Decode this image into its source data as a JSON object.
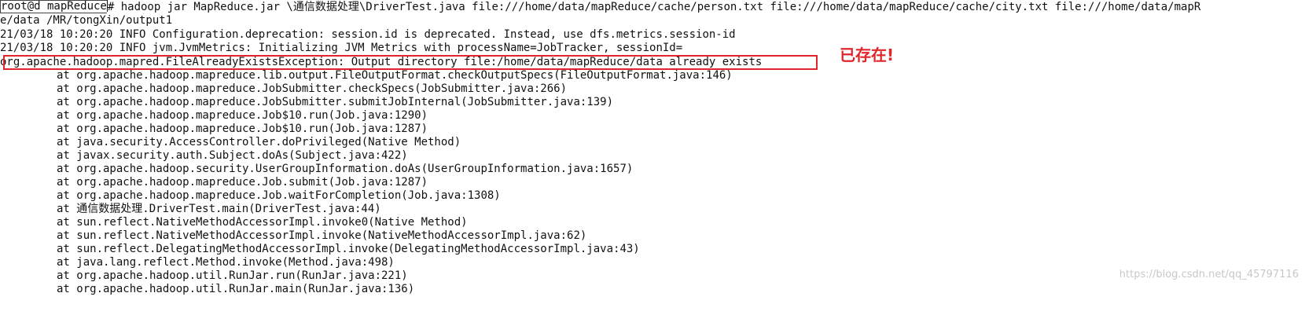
{
  "terminal": {
    "prompt": {
      "user_host": "root@d mapReduce",
      "symbol": "# ",
      "command": "hadoop jar MapReduce.jar \\通信数据处理\\DriverTest.java file:///home/data/mapReduce/cache/person.txt file:///home/data/mapReduce/cache/city.txt file:///home/data/mapR"
    },
    "lines": [
      "e/data /MR/tongXin/output1",
      "21/03/18 10:20:20 INFO Configuration.deprecation: session.id is deprecated. Instead, use dfs.metrics.session-id",
      "21/03/18 10:20:20 INFO jvm.JvmMetrics: Initializing JVM Metrics with processName=JobTracker, sessionId=",
      "org.apache.hadoop.mapred.FileAlreadyExistsException: Output directory file:/home/data/mapReduce/data already exists"
    ],
    "stack_trace": [
      "at org.apache.hadoop.mapreduce.lib.output.FileOutputFormat.checkOutputSpecs(FileOutputFormat.java:146)",
      "at org.apache.hadoop.mapreduce.JobSubmitter.checkSpecs(JobSubmitter.java:266)",
      "at org.apache.hadoop.mapreduce.JobSubmitter.submitJobInternal(JobSubmitter.java:139)",
      "at org.apache.hadoop.mapreduce.Job$10.run(Job.java:1290)",
      "at org.apache.hadoop.mapreduce.Job$10.run(Job.java:1287)",
      "at java.security.AccessController.doPrivileged(Native Method)",
      "at javax.security.auth.Subject.doAs(Subject.java:422)",
      "at org.apache.hadoop.security.UserGroupInformation.doAs(UserGroupInformation.java:1657)",
      "at org.apache.hadoop.mapreduce.Job.submit(Job.java:1287)",
      "at org.apache.hadoop.mapreduce.Job.waitForCompletion(Job.java:1308)",
      "at 通信数据处理.DriverTest.main(DriverTest.java:44)",
      "at sun.reflect.NativeMethodAccessorImpl.invoke0(Native Method)",
      "at sun.reflect.NativeMethodAccessorImpl.invoke(NativeMethodAccessorImpl.java:62)",
      "at sun.reflect.DelegatingMethodAccessorImpl.invoke(DelegatingMethodAccessorImpl.java:43)",
      "at java.lang.reflect.Method.invoke(Method.java:498)",
      "at org.apache.hadoop.util.RunJar.run(RunJar.java:221)",
      "at org.apache.hadoop.util.RunJar.main(RunJar.java:136)"
    ]
  },
  "annotation": {
    "text": "已存在!",
    "color": "#e0252b"
  },
  "watermark": {
    "text": "https://blog.csdn.net/qq_45797116"
  }
}
